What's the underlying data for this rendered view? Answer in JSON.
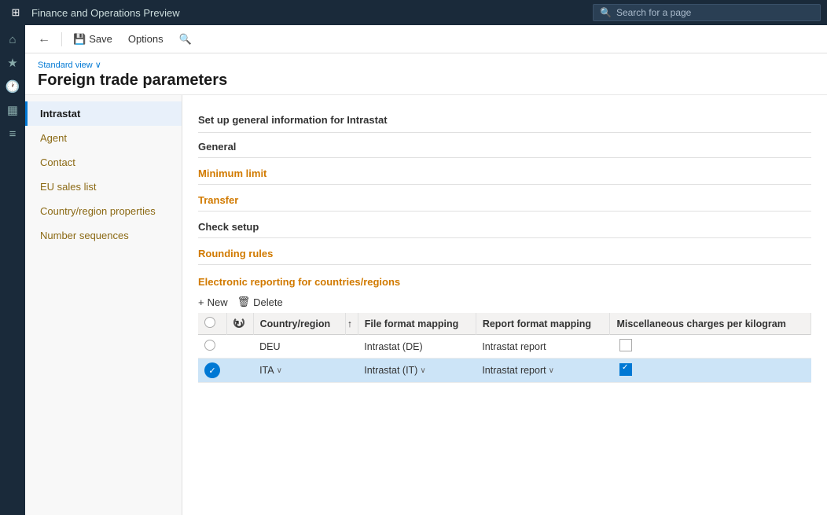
{
  "app": {
    "title": "Finance and Operations Preview",
    "search_placeholder": "Search for a page"
  },
  "toolbar": {
    "back_label": "←",
    "save_label": "Save",
    "options_label": "Options",
    "search_icon": "🔍"
  },
  "page": {
    "view_label": "Standard view",
    "title": "Foreign trade parameters"
  },
  "left_nav": {
    "items": [
      {
        "id": "intrastat",
        "label": "Intrastat",
        "active": true
      },
      {
        "id": "agent",
        "label": "Agent",
        "active": false
      },
      {
        "id": "contact",
        "label": "Contact",
        "active": false
      },
      {
        "id": "eu-sales-list",
        "label": "EU sales list",
        "active": false
      },
      {
        "id": "country-region",
        "label": "Country/region properties",
        "active": false
      },
      {
        "id": "number-sequences",
        "label": "Number sequences",
        "active": false
      }
    ]
  },
  "main": {
    "section_intro": "Set up general information for Intrastat",
    "sections": [
      {
        "id": "general",
        "label": "General"
      },
      {
        "id": "minimum-limit",
        "label": "Minimum limit"
      },
      {
        "id": "transfer",
        "label": "Transfer"
      },
      {
        "id": "check-setup",
        "label": "Check setup"
      },
      {
        "id": "rounding-rules",
        "label": "Rounding rules"
      }
    ],
    "er_section": {
      "title": "Electronic reporting for countries/regions",
      "new_label": "New",
      "delete_label": "Delete",
      "table": {
        "headers": [
          {
            "id": "select",
            "label": ""
          },
          {
            "id": "refresh",
            "label": ""
          },
          {
            "id": "country-region",
            "label": "Country/region"
          },
          {
            "id": "sort",
            "label": "↑"
          },
          {
            "id": "file-format",
            "label": "File format mapping"
          },
          {
            "id": "report-format",
            "label": "Report format mapping"
          },
          {
            "id": "misc-charges",
            "label": "Miscellaneous charges per kilogram"
          }
        ],
        "rows": [
          {
            "id": "row-deu",
            "selected": false,
            "indicator": false,
            "country": "DEU",
            "has_dropdown": false,
            "file_format": "Intrastat (DE)",
            "report_format": "Intrastat report",
            "misc_checked": false
          },
          {
            "id": "row-ita",
            "selected": true,
            "indicator": true,
            "country": "ITA",
            "has_dropdown": true,
            "file_format": "Intrastat (IT)",
            "report_format": "Intrastat report",
            "misc_checked": true
          }
        ]
      }
    }
  },
  "icons": {
    "apps": "⊞",
    "home": "⌂",
    "favorites": "★",
    "recent": "🕐",
    "modules": "▦",
    "list": "≡",
    "search": "🔍",
    "save": "💾",
    "plus": "+",
    "delete": "🗑",
    "chevron_down": "∨",
    "sort_up": "↑"
  }
}
